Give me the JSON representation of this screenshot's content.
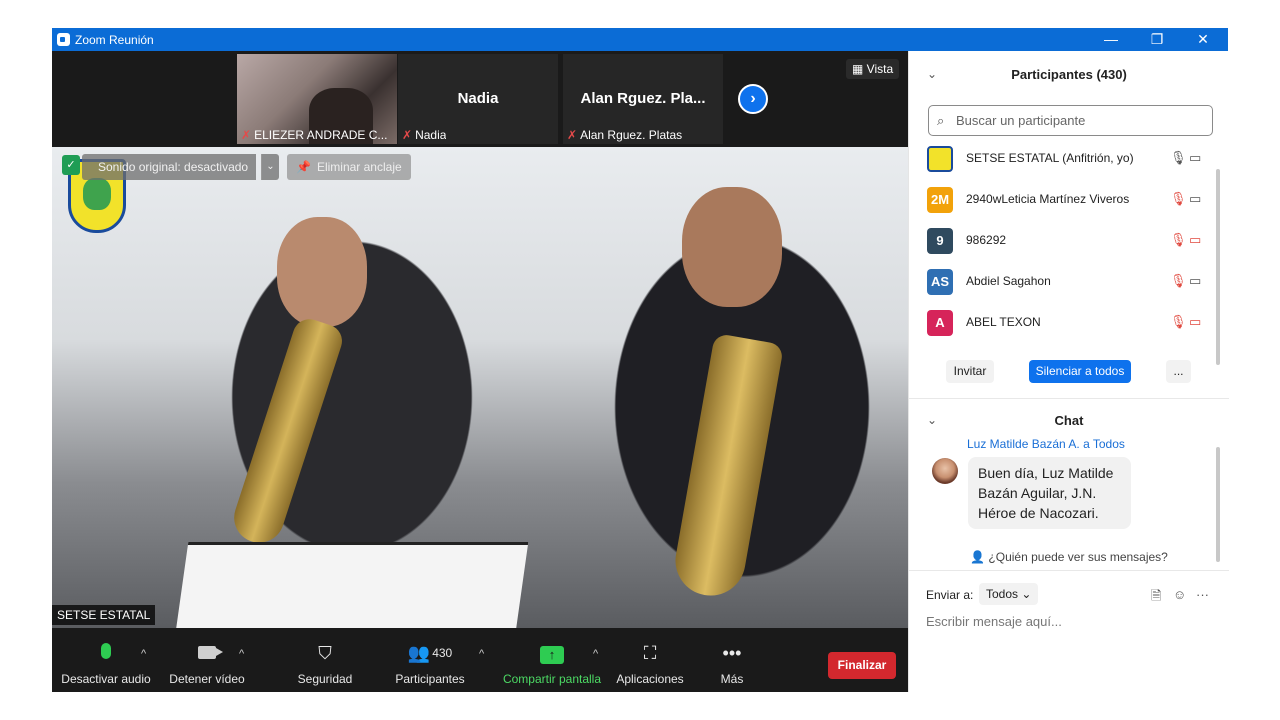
{
  "window": {
    "title": "Zoom Reunión",
    "min_glyph": "—",
    "restore_glyph": "❐",
    "close_glyph": "✕"
  },
  "strip": {
    "tiles": [
      {
        "name": "",
        "caption": "ELIEZER ANDRADE C..."
      },
      {
        "name": "Nadia",
        "caption": "Nadia"
      },
      {
        "name": "Alan  Rguez. Pla...",
        "caption": "Alan  Rguez. Platas"
      }
    ],
    "next_glyph": "›",
    "view_label": "Vista"
  },
  "video": {
    "sound_label": "Sonido original: desactivado",
    "sound_caret": "⌄",
    "unpin_label": "Eliminar anclaje",
    "speaker_name": "SETSE ESTATAL",
    "security_badge": "✓"
  },
  "toolbar": {
    "mute_audio": "Desactivar audio",
    "stop_video": "Detener vídeo",
    "security": "Seguridad",
    "participants": "Participantes",
    "participants_count": "430",
    "share_screen": "Compartir pantalla",
    "apps": "Aplicaciones",
    "more": "Más",
    "end": "Finalizar",
    "caret": "^",
    "share_arrow": "↑",
    "more_glyph": "•••"
  },
  "participants_panel": {
    "title": "Participantes (430)",
    "search_placeholder": "Buscar un participante",
    "people": [
      {
        "initials": "",
        "name": "SETSE ESTATAL (Anfitrión, yo)",
        "color": "#f2e22a",
        "mic_muted": false,
        "cam_off": false
      },
      {
        "initials": "2M",
        "name": "2940wLeticia Martínez Viveros",
        "color": "#f2a20a",
        "mic_muted": true,
        "cam_off": false
      },
      {
        "initials": "9",
        "name": "986292",
        "color": "#2f4a5f",
        "mic_muted": true,
        "cam_off": true
      },
      {
        "initials": "AS",
        "name": "Abdiel Sagahon",
        "color": "#2f6fb3",
        "mic_muted": true,
        "cam_off": false
      },
      {
        "initials": "A",
        "name": "ABEL TEXON",
        "color": "#d6245a",
        "mic_muted": true,
        "cam_off": true
      }
    ],
    "invite": "Invitar",
    "mute_all": "Silenciar a todos",
    "more": "..."
  },
  "chat_panel": {
    "title": "Chat",
    "sender": "Luz Matilde Bazán A. a Todos",
    "message": "Buen día, Luz Matilde Bazán Aguilar, J.N. Héroe de Nacozari.",
    "who_can_see": "¿Quién puede ver sus mensajes?",
    "send_to_label": "Enviar a:",
    "send_to_value": "Todos ⌄",
    "placeholder": "Escribir mensaje aquí..."
  },
  "icons": {
    "collapse": "⌄",
    "search": "⌕",
    "mic": "🎙",
    "mic_muted": "🎙̸",
    "cam": "▭◂",
    "file": "🗎",
    "emoji": "☺",
    "ellipsis": "···",
    "muted_small": "✗"
  }
}
